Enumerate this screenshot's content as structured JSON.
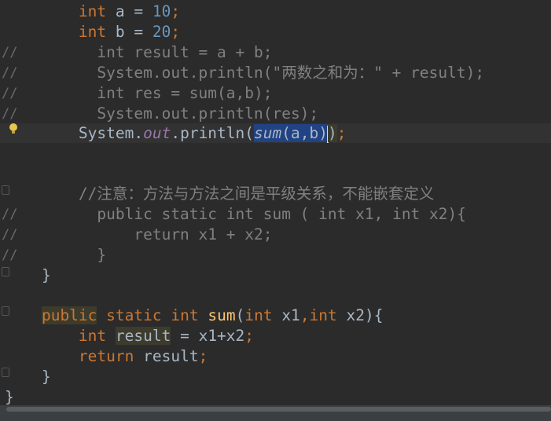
{
  "editor": {
    "lines": [
      {
        "g": "",
        "t": "        int a = 10;"
      },
      {
        "g": "",
        "t": "        int b = 20;"
      },
      {
        "g": "//",
        "t": "          int result = a + b;"
      },
      {
        "g": "//",
        "t": "          System.out.println(\"两数之和为：\" + result);"
      },
      {
        "g": "//",
        "t": "          int res = sum(a,b);"
      },
      {
        "g": "//",
        "t": "          System.out.println(res);"
      },
      {
        "g": "",
        "t": "        System.out.println(sum(a,b));"
      },
      {
        "g": "",
        "t": ""
      },
      {
        "g": "",
        "t": ""
      },
      {
        "g": "",
        "t": "        //注意：方法与方法之间是平级关系，不能嵌套定义"
      },
      {
        "g": "//",
        "t": "          public static int sum ( int x1, int x2){"
      },
      {
        "g": "//",
        "t": "              return x1 + x2;"
      },
      {
        "g": "//",
        "t": "          }"
      },
      {
        "g": "",
        "t": "    }"
      },
      {
        "g": "",
        "t": ""
      },
      {
        "g": "",
        "t": "    public static int sum(int x1,int x2){"
      },
      {
        "g": "",
        "t": "        int result = x1+x2;"
      },
      {
        "g": "",
        "t": "        return result;"
      },
      {
        "g": "",
        "t": "    }"
      },
      {
        "g": "",
        "t": "}"
      }
    ]
  },
  "colors": {
    "background": "#2b2b2b",
    "keyword": "#cc7832",
    "number": "#6897bb",
    "comment": "#808080",
    "selection": "#214283"
  }
}
